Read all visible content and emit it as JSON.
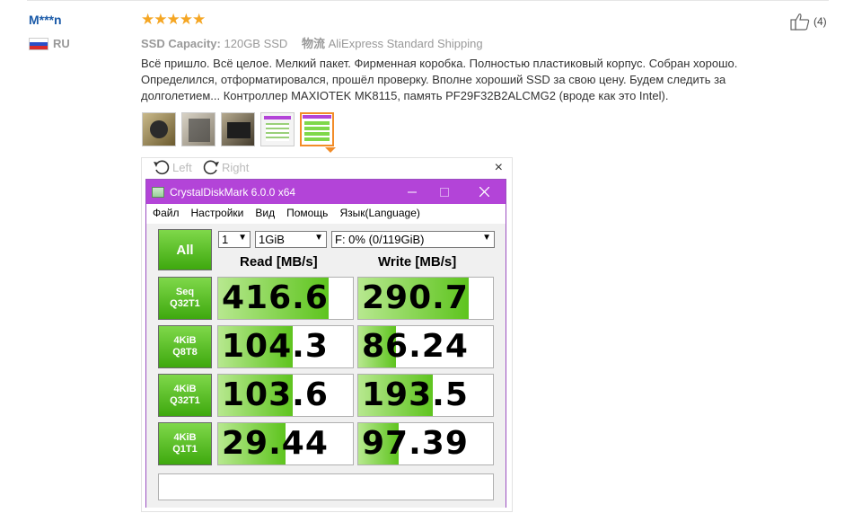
{
  "review": {
    "author": "M***n",
    "country": "RU",
    "stars": "★★★★★",
    "meta": {
      "capacity_label": "SSD Capacity:",
      "capacity_value": "120GB SSD",
      "shipping_label": "物流",
      "shipping_value": "AliExpress Standard Shipping"
    },
    "text": "Всё пришло. Всё целое. Мелкий пакет. Фирменная коробка. Полностью пластиковый корпус. Собран хорошо. Определился, отформатировался, прошёл проверку. Вполне хороший SSD за свою цену. Будем следить за долголетием... Контроллер MAXIOTEK MK8115, память PF29F32B2ALCMG2 (вроде как это Intel).",
    "likes": "(4)"
  },
  "viewer": {
    "rotate_left": "Left",
    "rotate_right": "Right",
    "close": "×"
  },
  "cdm": {
    "title": "CrystalDiskMark 6.0.0 x64",
    "menu": [
      "Файл",
      "Настройки",
      "Вид",
      "Помощь",
      "Язык(Language)"
    ],
    "all_button": "All",
    "count_select": "1",
    "size_select": "1GiB",
    "drive_select": "F: 0% (0/119GiB)",
    "read_header": "Read [MB/s]",
    "write_header": "Write [MB/s]",
    "rows": [
      {
        "label1": "Seq",
        "label2": "Q32T1",
        "read": "416.6",
        "write": "290.7",
        "read_fill": 0.82,
        "write_fill": 0.82
      },
      {
        "label1": "4KiB",
        "label2": "Q8T8",
        "read": "104.3",
        "write": "86.24",
        "read_fill": 0.55,
        "write_fill": 0.28
      },
      {
        "label1": "4KiB",
        "label2": "Q32T1",
        "read": "103.6",
        "write": "193.5",
        "read_fill": 0.55,
        "write_fill": 0.55
      },
      {
        "label1": "4KiB",
        "label2": "Q1T1",
        "read": "29.44",
        "write": "97.39",
        "read_fill": 0.5,
        "write_fill": 0.3
      }
    ]
  }
}
